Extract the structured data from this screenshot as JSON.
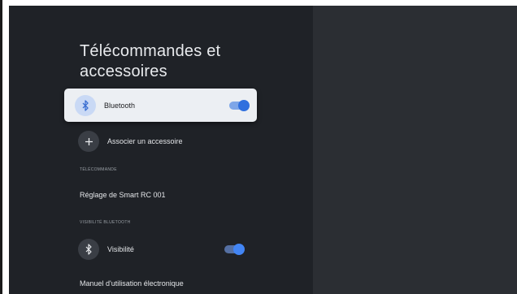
{
  "page": {
    "title": "Télécommandes et accessoires"
  },
  "items": {
    "bluetooth": {
      "label": "Bluetooth",
      "toggle_on": true
    },
    "add_accessory": {
      "label": "Associer un accessoire"
    },
    "remote_section": {
      "label": "TÉLÉCOMMANDE"
    },
    "remote_settings": {
      "label": "Réglage de Smart RC 001"
    },
    "visibility_section": {
      "label": "VISIBILITÉ BLUETOOTH"
    },
    "visibility": {
      "label": "Visibilité",
      "toggle_on": true
    },
    "manual": {
      "label": "Manuel d'utilisation électronique"
    }
  },
  "icons": {
    "bluetooth": "bluetooth-icon",
    "add": "plus-icon"
  },
  "colors": {
    "accent": "#2f6fde",
    "card": "#eceff3",
    "background": "#1f2227"
  }
}
